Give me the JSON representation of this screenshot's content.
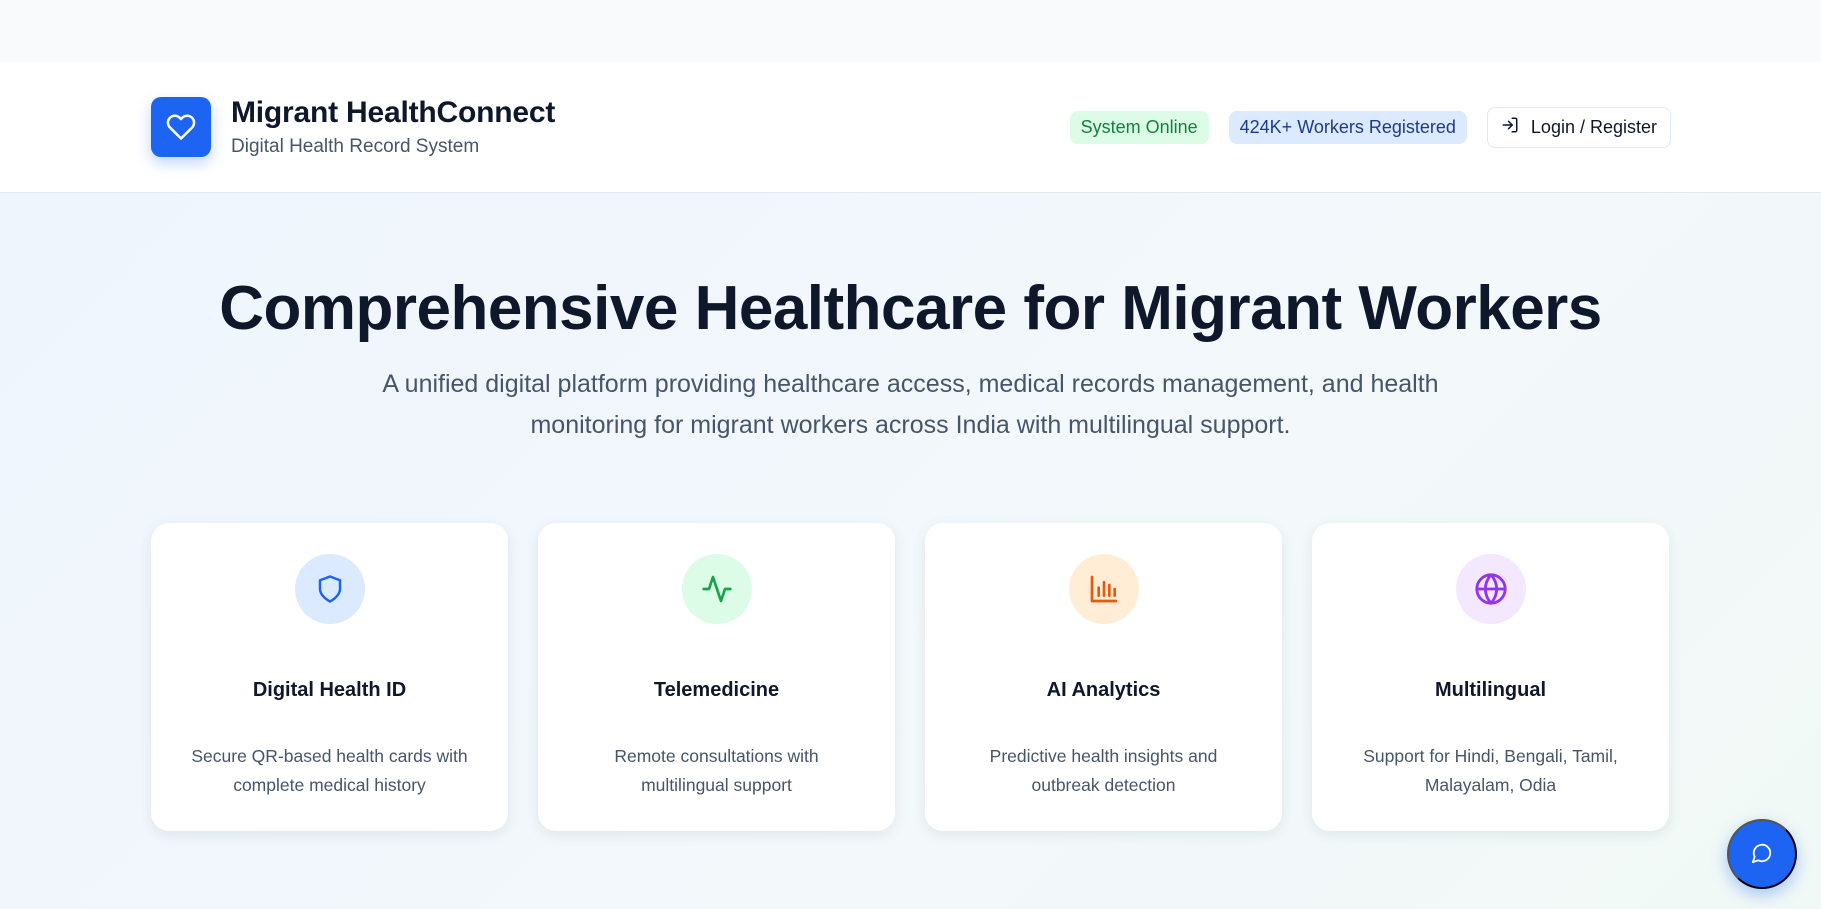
{
  "header": {
    "app_title": "Migrant HealthConnect",
    "app_subtitle": "Digital Health Record System",
    "status_badge": "System Online",
    "workers_badge": "424K+ Workers Registered",
    "login_label": "Login / Register"
  },
  "hero": {
    "title": "Comprehensive Healthcare for Migrant Workers",
    "description_line1": "A unified digital platform providing healthcare access, medical records management, and health",
    "description_line2": "monitoring for migrant workers across India with multilingual support."
  },
  "features": [
    {
      "icon": "shield-icon",
      "title": "Digital Health ID",
      "desc_line1": "Secure QR-based health cards with",
      "desc_line2": "complete medical history",
      "icon_bg": "#dbeafe",
      "icon_color": "#1d64f2"
    },
    {
      "icon": "activity-icon",
      "title": "Telemedicine",
      "desc_line1": "Remote consultations with",
      "desc_line2": "multilingual support",
      "icon_bg": "#dcfce7",
      "icon_color": "#16a34a"
    },
    {
      "icon": "bar-chart-icon",
      "title": "AI Analytics",
      "desc_line1": "Predictive health insights and",
      "desc_line2": "outbreak detection",
      "icon_bg": "#ffedd5",
      "icon_color": "#ea580c"
    },
    {
      "icon": "globe-icon",
      "title": "Multilingual",
      "desc_line1": "Support for Hindi, Bengali, Tamil,",
      "desc_line2": "Malayalam, Odia",
      "icon_bg": "#f3e8ff",
      "icon_color": "#9333ea"
    }
  ],
  "colors": {
    "brand_primary": "#1d64f2",
    "text_dark": "#0f172a",
    "text_muted": "#475569",
    "online_bg": "#dcfce7",
    "online_text": "#15803d",
    "workers_bg": "#dbeafe",
    "workers_text": "#1e3a8a"
  },
  "chat": {
    "icon": "message-circle-icon"
  }
}
